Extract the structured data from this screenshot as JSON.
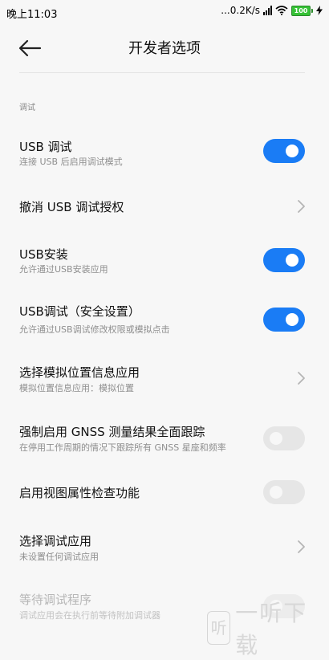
{
  "status_bar": {
    "time": "晚上11:03",
    "network_speed": "...0.2K/s",
    "signal_label": "HD",
    "battery": "100"
  },
  "header": {
    "title": "开发者选项",
    "back_icon": "arrow-left-icon"
  },
  "section_label": "调试",
  "rows": [
    {
      "title": "USB 调试",
      "subtitle": "连接 USB 后启用调试模式",
      "control": "toggle",
      "state": "on"
    },
    {
      "title": "撤消 USB 调试授权",
      "subtitle": "",
      "control": "chevron"
    },
    {
      "title": "USB安装",
      "subtitle": "允许通过USB安装应用",
      "control": "toggle",
      "state": "on"
    },
    {
      "title": "USB调试（安全设置）",
      "subtitle": "允许通过USB调试修改权限或模拟点击",
      "control": "toggle",
      "state": "on"
    },
    {
      "title": "选择模拟位置信息应用",
      "subtitle": "模拟位置信息应用：模拟位置",
      "control": "chevron"
    },
    {
      "title": "强制启用 GNSS 测量结果全面跟踪",
      "subtitle": "在停用工作周期的情况下跟踪所有 GNSS 星座和频率",
      "control": "toggle",
      "state": "off"
    },
    {
      "title": "启用视图属性检查功能",
      "subtitle": "",
      "control": "toggle",
      "state": "off"
    },
    {
      "title": "选择调试应用",
      "subtitle": "未设置任何调试应用",
      "control": "chevron"
    },
    {
      "title": "等待调试程序",
      "subtitle": "调试应用会在执行前等待附加调试器",
      "control": "toggle",
      "state": "off",
      "disabled": true
    }
  ],
  "watermark": {
    "badge": "听",
    "text": "一听下载"
  },
  "colors": {
    "accent": "#1a7cf5",
    "toggle_off": "#e6e6e6",
    "background": "#f7f7f7"
  }
}
